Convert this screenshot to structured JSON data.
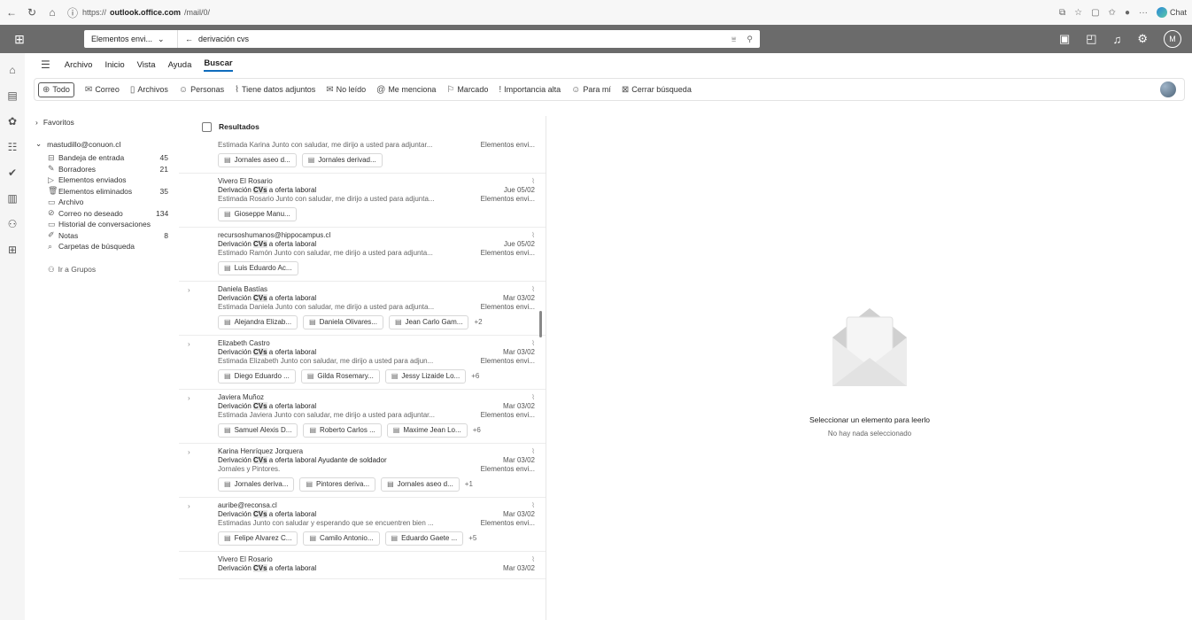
{
  "browser": {
    "url_prefix": "https://",
    "url_host": "outlook.office.com",
    "url_path": "/mail/0/",
    "chat_label": "Chat"
  },
  "header": {
    "scope": "Elementos envi...",
    "search_term": "derivación cvs",
    "avatar_initial": "M"
  },
  "ribbon": {
    "tabs": [
      "Archivo",
      "Inicio",
      "Vista",
      "Ayuda",
      "Buscar"
    ]
  },
  "filters": [
    "Todo",
    "Correo",
    "Archivos",
    "Personas",
    "Tiene datos adjuntos",
    "No leído",
    "Me menciona",
    "Marcado",
    "Importancia alta",
    "Para mí",
    "Cerrar búsqueda"
  ],
  "folders": {
    "favorites": "Favoritos",
    "account": "mastudillo@conuon.cl",
    "items": [
      {
        "label": "Bandeja de entrada",
        "count": "45"
      },
      {
        "label": "Borradores",
        "count": "21"
      },
      {
        "label": "Elementos enviados",
        "count": ""
      },
      {
        "label": "Elementos eliminados",
        "count": "35"
      },
      {
        "label": "Archivo",
        "count": ""
      },
      {
        "label": "Correo no deseado",
        "count": "134"
      },
      {
        "label": "Historial de conversaciones",
        "count": ""
      },
      {
        "label": "Notas",
        "count": "8"
      },
      {
        "label": "Carpetas de búsqueda",
        "count": ""
      }
    ],
    "groups": "Ir a Grupos"
  },
  "list": {
    "header": "Resultados",
    "messages": [
      {
        "sender": "",
        "subject_pre": "",
        "subject_hl": "",
        "subject_post": "",
        "date": "",
        "preview": "Estimada Karina Junto con saludar, me dirijo a usted para adjuntar...",
        "folder": "Elementos envi...",
        "chips": [
          "Jornales aseo d...",
          "Jornales derivad..."
        ],
        "more": ""
      },
      {
        "sender": "Vivero El Rosario",
        "subject_pre": "Derivación ",
        "subject_hl": "CVs",
        "subject_post": " a oferta laboral",
        "date": "Jue 05/02",
        "preview": "Estimada Rosario Junto con saludar, me dirijo a usted para adjunta...",
        "folder": "Elementos envi...",
        "chips": [
          "Gioseppe Manu..."
        ],
        "more": ""
      },
      {
        "sender": "recursoshumanos@hippocampus.cl",
        "subject_pre": "Derivación ",
        "subject_hl": "CVs",
        "subject_post": " a oferta laboral",
        "date": "Jue 05/02",
        "preview": "Estimado Ramón Junto con saludar, me dirijo a usted para adjunta...",
        "folder": "Elementos envi...",
        "chips": [
          "Luis Eduardo Ac..."
        ],
        "more": ""
      },
      {
        "sender": "Daniela Bastías",
        "subject_pre": "Derivación ",
        "subject_hl": "CVs",
        "subject_post": " a oferta laboral",
        "date": "Mar 03/02",
        "preview": "Estimada Daniela Junto con saludar, me dirijo a usted para adjunta...",
        "folder": "Elementos envi...",
        "chips": [
          "Alejandra Elizab...",
          "Daniela Olivares...",
          "Jean Carlo Gam..."
        ],
        "more": "+2"
      },
      {
        "sender": "Elizabeth Castro",
        "subject_pre": "Derivación ",
        "subject_hl": "CVs",
        "subject_post": " a oferta laboral",
        "date": "Mar 03/02",
        "preview": "Estimada Elizabeth Junto con saludar, me dirijo a usted para adjun...",
        "folder": "Elementos envi...",
        "chips": [
          "Diego Eduardo ...",
          "Gilda Rosemary...",
          "Jessy Lizaide Lo..."
        ],
        "more": "+6"
      },
      {
        "sender": "Javiera Muñoz",
        "subject_pre": "Derivación ",
        "subject_hl": "CVs",
        "subject_post": " a oferta laboral",
        "date": "Mar 03/02",
        "preview": "Estimada Javiera Junto con saludar, me dirijo a usted para adjuntar...",
        "folder": "Elementos envi...",
        "chips": [
          "Samuel Alexis D...",
          "Roberto Carlos ...",
          "Maxime Jean Lo..."
        ],
        "more": "+6"
      },
      {
        "sender": "Karina Henríquez Jorquera",
        "subject_pre": "Derivación ",
        "subject_hl": "CVs",
        "subject_post": " a oferta laboral Ayudante de soldador",
        "date": "Mar 03/02",
        "preview": "Jornales y Pintores.",
        "folder": "Elementos envi...",
        "chips": [
          "Jornales deriva...",
          "Pintores deriva...",
          "Jornales aseo d..."
        ],
        "more": "+1"
      },
      {
        "sender": "auribe@reconsa.cl",
        "subject_pre": "Derivación ",
        "subject_hl": "CVs",
        "subject_post": " a oferta laboral",
        "date": "Mar 03/02",
        "preview": "Estimadas Junto con saludar y esperando que se encuentren bien ...",
        "folder": "Elementos envi...",
        "chips": [
          "Felipe Alvarez C...",
          "Camilo Antonio...",
          "Eduardo Gaete ..."
        ],
        "more": "+5"
      },
      {
        "sender": "Vivero El Rosario",
        "subject_pre": "Derivación ",
        "subject_hl": "CVs",
        "subject_post": " a oferta laboral",
        "date": "Mar 03/02",
        "preview": "",
        "folder": "",
        "chips": [],
        "more": ""
      }
    ]
  },
  "reading": {
    "title": "Seleccionar un elemento para leerlo",
    "subtitle": "No hay nada seleccionado"
  }
}
